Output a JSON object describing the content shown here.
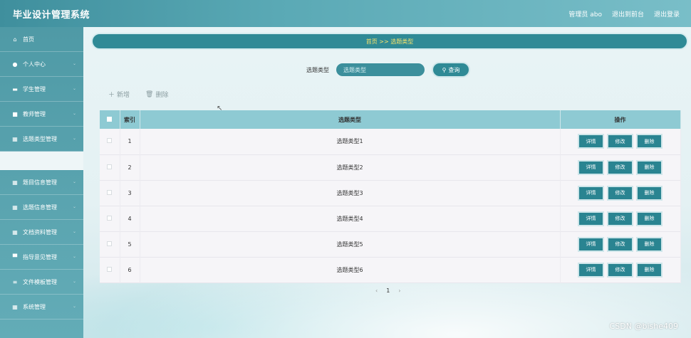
{
  "header": {
    "brand": "毕业设计管理系统",
    "user": "管理员 abo",
    "backend": "退出到前台",
    "logout": "退出登录"
  },
  "sidebar": {
    "items": [
      {
        "label": "首页",
        "icon": "home-icon",
        "chev": ""
      },
      {
        "label": "个人中心",
        "icon": "user-icon",
        "chev": "⌄"
      },
      {
        "label": "学生管理",
        "icon": "group-icon",
        "chev": "⌄"
      },
      {
        "label": "教师管理",
        "icon": "teacher-icon",
        "chev": "⌄"
      },
      {
        "label": "选题类型管理",
        "icon": "grid-icon",
        "chev": "⌄"
      },
      {
        "label": "题目信息管理",
        "icon": "grid-icon",
        "chev": "⌄"
      },
      {
        "label": "选题信息管理",
        "icon": "grid-icon",
        "chev": "⌄"
      },
      {
        "label": "文档资料管理",
        "icon": "grid-icon",
        "chev": "⌄"
      },
      {
        "label": "指导意见管理",
        "icon": "comment-icon",
        "chev": "⌄"
      },
      {
        "label": "文件模板管理",
        "icon": "list-icon",
        "chev": "⌄"
      },
      {
        "label": "系统管理",
        "icon": "grid-icon",
        "chev": "⌄"
      }
    ]
  },
  "breadcrumb": "首页 >> 选题类型",
  "search": {
    "label": "选题类型",
    "placeholder": "选题类型",
    "button": "查询"
  },
  "actions": {
    "add": "新增",
    "delete": "删除"
  },
  "table": {
    "headers": {
      "index": "索引",
      "type": "选题类型",
      "ops": "操作"
    },
    "rows": [
      {
        "index": "1",
        "type": "选题类型1"
      },
      {
        "index": "2",
        "type": "选题类型2"
      },
      {
        "index": "3",
        "type": "选题类型3"
      },
      {
        "index": "4",
        "type": "选题类型4"
      },
      {
        "index": "5",
        "type": "选题类型5"
      },
      {
        "index": "6",
        "type": "选题类型6"
      }
    ],
    "ops": {
      "detail": "详情",
      "edit": "修改",
      "delete": "删除"
    }
  },
  "pager": {
    "prev": "‹",
    "page": "1",
    "next": "›"
  },
  "watermark": "CSDN @bishe409",
  "colors": {
    "accent": "#2f8a96",
    "breadcrumb_text": "#f7e36b",
    "table_header": "#8ecad3"
  }
}
